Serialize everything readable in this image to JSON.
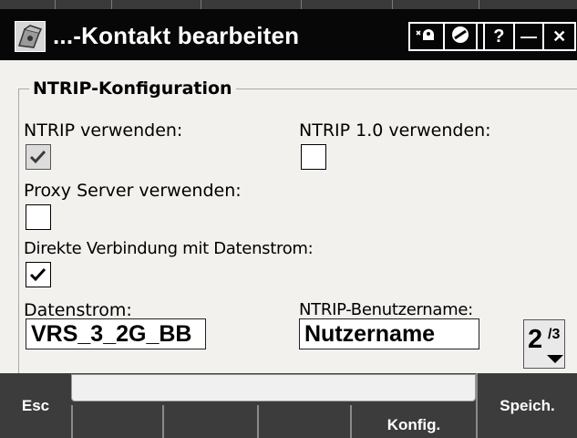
{
  "window": {
    "title": "...-Kontakt bearbeiten",
    "toolbar_buttons": [
      {
        "icon": "keyboard-toggle-icon"
      },
      {
        "icon": "no-entry-icon"
      },
      {
        "label": "ab"
      }
    ],
    "help_label": "?",
    "minimize_label": "—",
    "close_label": "✕"
  },
  "group": {
    "legend": "NTRIP-Konfiguration"
  },
  "options": {
    "ntrip_use": {
      "label": "NTRIP verwenden:",
      "checked": true,
      "enabled": false
    },
    "ntrip10": {
      "label": "NTRIP 1.0 verwenden:",
      "checked": false
    },
    "proxy": {
      "label": "Proxy Server verwenden:",
      "checked": false
    },
    "direct": {
      "label": "Direkte Verbindung mit Datenstrom:",
      "checked": true
    }
  },
  "fields": {
    "stream": {
      "label": "Datenstrom:",
      "value": "VRS_3_2G_BB"
    },
    "username": {
      "label": "NTRIP-Benutzername:",
      "value": "Nutzername"
    }
  },
  "pager": {
    "current": "2",
    "total": "/3"
  },
  "bottom": {
    "esc_label": "Esc",
    "config_label": "Konfig.",
    "save_label": "Speich."
  },
  "colors": {
    "titlebar": "#070707",
    "bottombar": "#3c3c3c",
    "background": "#f3f1ee"
  }
}
